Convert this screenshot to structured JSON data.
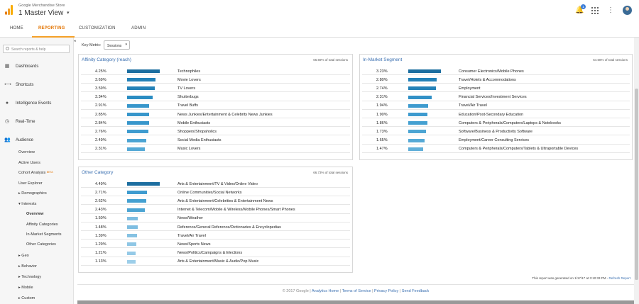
{
  "header": {
    "product": "Google Merchandise Store",
    "view": "1 Master View",
    "notifications_count": "1"
  },
  "tabs": [
    {
      "label": "HOME"
    },
    {
      "label": "REPORTING"
    },
    {
      "label": "CUSTOMIZATION"
    },
    {
      "label": "ADMIN"
    }
  ],
  "sidebar": {
    "search_placeholder": "Search reports & help",
    "main_items": [
      {
        "label": "Dashboards"
      },
      {
        "label": "Shortcuts"
      },
      {
        "label": "Intelligence Events"
      },
      {
        "label": "Real-Time"
      },
      {
        "label": "Audience"
      }
    ],
    "audience_items": [
      "Overview",
      "Active Users",
      "Cohort Analysis",
      "User Explorer",
      "Demographics",
      "Interests"
    ],
    "beta": "BETA",
    "interests_items": [
      "Overview",
      "Affinity Categories",
      "In-Market Segments",
      "Other Categories"
    ],
    "more_items": [
      "Geo",
      "Behavior",
      "Technology",
      "Mobile",
      "Custom"
    ]
  },
  "key_metric": {
    "label": "Key Metric:",
    "value": "Sessions"
  },
  "panels": {
    "affinity": {
      "title": "Affinity Category (reach)",
      "pct": "66.69% of total sessions",
      "rows": [
        {
          "value": "4.25%",
          "category": "Technophiles",
          "fill": 1.0,
          "color": "#1c6ea0"
        },
        {
          "value": "3.69%",
          "category": "Movie Lovers",
          "fill": 0.87,
          "color": "#2381b7"
        },
        {
          "value": "3.59%",
          "category": "TV Lovers",
          "fill": 0.84,
          "color": "#2381b7"
        },
        {
          "value": "3.34%",
          "category": "Shutterbugs",
          "fill": 0.79,
          "color": "#2a8cc2"
        },
        {
          "value": "2.91%",
          "category": "Travel Buffs",
          "fill": 0.68,
          "color": "#3796cb"
        },
        {
          "value": "2.85%",
          "category": "News Junkies/Entertainment & Celebrity News Junkies",
          "fill": 0.67,
          "color": "#3796cb"
        },
        {
          "value": "2.84%",
          "category": "Mobile Enthusiasts",
          "fill": 0.67,
          "color": "#3796cb"
        },
        {
          "value": "2.76%",
          "category": "Shoppers/Shopaholics",
          "fill": 0.65,
          "color": "#3e9bcf"
        },
        {
          "value": "2.49%",
          "category": "Social Media Enthusiasts",
          "fill": 0.59,
          "color": "#4ca4d3"
        },
        {
          "value": "2.31%",
          "category": "Music Lovers",
          "fill": 0.54,
          "color": "#55a9d6"
        }
      ]
    },
    "inmarket": {
      "title": "In-Market Segment",
      "pct": "64.68% of total sessions",
      "rows": [
        {
          "value": "3.23%",
          "category": "Consumer Electronics/Mobile Phones",
          "fill": 1.0,
          "color": "#1c6ea0"
        },
        {
          "value": "2.80%",
          "category": "Travel/Hotels & Accommodations",
          "fill": 0.87,
          "color": "#2381b7"
        },
        {
          "value": "2.74%",
          "category": "Employment",
          "fill": 0.85,
          "color": "#2381b7"
        },
        {
          "value": "2.31%",
          "category": "Financial Services/Investment Services",
          "fill": 0.72,
          "color": "#3190c6"
        },
        {
          "value": "1.94%",
          "category": "Travel/Air Travel",
          "fill": 0.6,
          "color": "#3e9bcf"
        },
        {
          "value": "1.90%",
          "category": "Education/Post-Secondary Education",
          "fill": 0.59,
          "color": "#3e9bcf"
        },
        {
          "value": "1.86%",
          "category": "Computers & Peripherals/Computers/Laptops & Notebooks",
          "fill": 0.58,
          "color": "#44a0d1"
        },
        {
          "value": "1.73%",
          "category": "Software/Business & Productivity Software",
          "fill": 0.54,
          "color": "#4ca4d3"
        },
        {
          "value": "1.65%",
          "category": "Employment/Career Consulting Services",
          "fill": 0.51,
          "color": "#55a9d6"
        },
        {
          "value": "1.47%",
          "category": "Computers & Peripherals/Computers/Tablets & Ultraportable Devices",
          "fill": 0.46,
          "color": "#60afd9"
        }
      ]
    },
    "other": {
      "title": "Other Category",
      "pct": "66.73% of total sessions",
      "rows": [
        {
          "value": "4.49%",
          "category": "Arts & Entertainment/TV & Video/Online Video",
          "fill": 1.0,
          "color": "#1c6ea0"
        },
        {
          "value": "2.71%",
          "category": "Online Communities/Social Networks",
          "fill": 0.6,
          "color": "#3e9bcf"
        },
        {
          "value": "2.62%",
          "category": "Arts & Entertainment/Celebrities & Entertainment News",
          "fill": 0.58,
          "color": "#44a0d1"
        },
        {
          "value": "2.43%",
          "category": "Internet & Telecom/Mobile & Wireless/Mobile Phones/Smart Phones",
          "fill": 0.54,
          "color": "#4ca4d3"
        },
        {
          "value": "1.50%",
          "category": "News/Weather",
          "fill": 0.33,
          "color": "#7dbde1"
        },
        {
          "value": "1.48%",
          "category": "Reference/General Reference/Dictionaries & Encyclopedias",
          "fill": 0.33,
          "color": "#7dbde1"
        },
        {
          "value": "1.39%",
          "category": "Travel/Air Travel",
          "fill": 0.31,
          "color": "#86c2e3"
        },
        {
          "value": "1.29%",
          "category": "News/Sports News",
          "fill": 0.29,
          "color": "#8ec6e5"
        },
        {
          "value": "1.21%",
          "category": "News/Politics/Campaigns & Elections",
          "fill": 0.27,
          "color": "#95cae7"
        },
        {
          "value": "1.13%",
          "category": "Arts & Entertainment/Music & Audio/Pop Music",
          "fill": 0.25,
          "color": "#9ccee9"
        }
      ]
    }
  },
  "report_generated": {
    "text": "This report was generated on 1/17/17 at 3:10:33 PM -",
    "link": "Refresh Report"
  },
  "footer": {
    "copyright": "© 2017 Google |",
    "links": [
      "Analytics Home",
      "Terms of Service",
      "Privacy Policy",
      "Send Feedback"
    ]
  }
}
